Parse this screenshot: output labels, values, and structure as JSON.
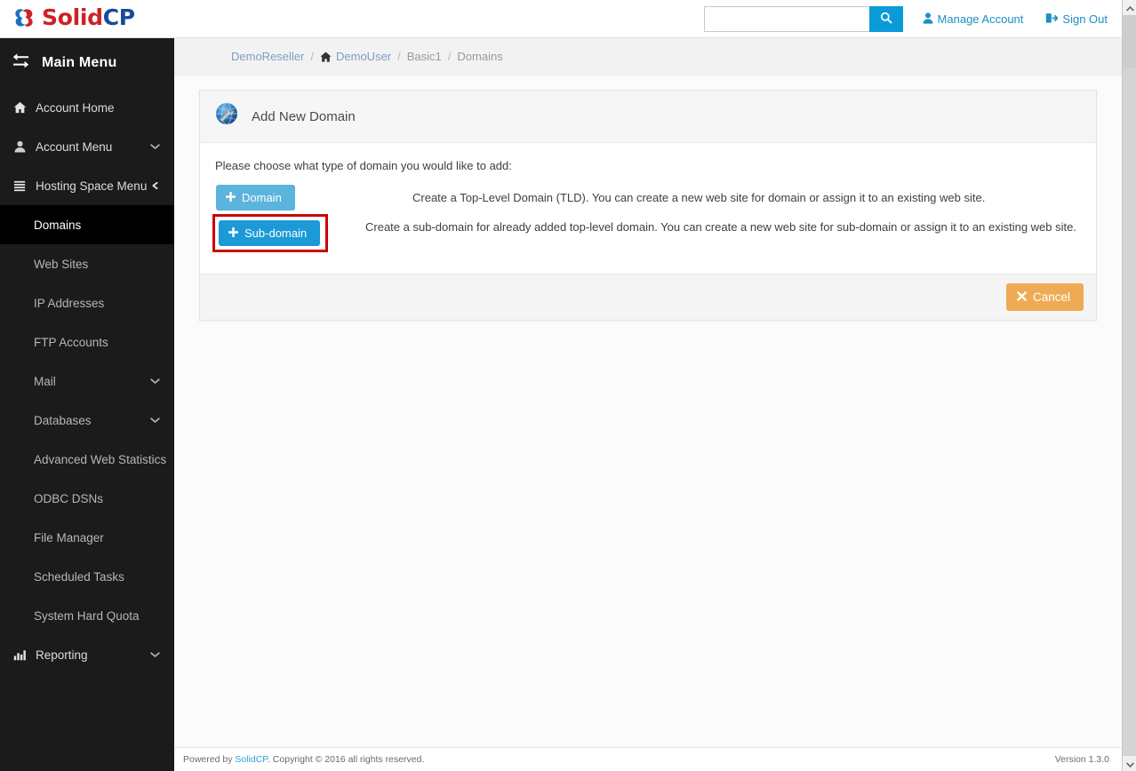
{
  "brand": {
    "logo_solid": "Solid",
    "logo_cp": "CP",
    "logo_icon": "solidcp-cloud-logo-icon",
    "accent_blue": "#0b9bd8",
    "logo_red": "#cf2026",
    "logo_navy": "#1b4a9c"
  },
  "header": {
    "search_value": "",
    "search_placeholder": "",
    "search_icon": "search-icon",
    "manage_account_label": "Manage Account",
    "manage_account_icon": "user-icon",
    "sign_out_label": "Sign Out",
    "sign_out_icon": "sign-out-icon"
  },
  "sidebar": {
    "title": "Main Menu",
    "title_icon": "exchange-arrows-icon",
    "items": [
      {
        "label": "Account Home",
        "icon": "home-icon",
        "level": 1,
        "chevron": "",
        "active": false
      },
      {
        "label": "Account Menu",
        "icon": "user-icon",
        "level": 1,
        "chevron": "down",
        "active": false
      },
      {
        "label": "Hosting Space Menu",
        "icon": "list-icon",
        "level": 1,
        "chevron": "left",
        "active": false
      },
      {
        "label": "Domains",
        "icon": "",
        "level": 2,
        "chevron": "",
        "active": true
      },
      {
        "label": "Web Sites",
        "icon": "",
        "level": 2,
        "chevron": "",
        "active": false
      },
      {
        "label": "IP Addresses",
        "icon": "",
        "level": 2,
        "chevron": "",
        "active": false
      },
      {
        "label": "FTP Accounts",
        "icon": "",
        "level": 2,
        "chevron": "",
        "active": false
      },
      {
        "label": "Mail",
        "icon": "",
        "level": 2,
        "chevron": "down",
        "active": false
      },
      {
        "label": "Databases",
        "icon": "",
        "level": 2,
        "chevron": "down",
        "active": false
      },
      {
        "label": "Advanced Web Statistics",
        "icon": "",
        "level": 2,
        "chevron": "",
        "active": false
      },
      {
        "label": "ODBC DSNs",
        "icon": "",
        "level": 2,
        "chevron": "",
        "active": false
      },
      {
        "label": "File Manager",
        "icon": "",
        "level": 2,
        "chevron": "",
        "active": false
      },
      {
        "label": "Scheduled Tasks",
        "icon": "",
        "level": 2,
        "chevron": "",
        "active": false
      },
      {
        "label": "System Hard Quota",
        "icon": "",
        "level": 2,
        "chevron": "",
        "active": false
      },
      {
        "label": "Reporting",
        "icon": "chart-bar-icon",
        "level": 1,
        "chevron": "down",
        "active": false
      }
    ]
  },
  "breadcrumb": {
    "items": [
      {
        "label": "DemoReseller",
        "type": "link",
        "icon": ""
      },
      {
        "label": "DemoUser",
        "type": "link",
        "icon": "home-icon"
      },
      {
        "label": "Basic1",
        "type": "static",
        "icon": ""
      },
      {
        "label": "Domains",
        "type": "static",
        "icon": ""
      }
    ],
    "separator": "/"
  },
  "panel": {
    "title": "Add New Domain",
    "title_icon": "globe-wrench-icon",
    "prompt": "Please choose what type of domain you would like to add:",
    "choices": [
      {
        "button_label": "Domain",
        "button_icon": "plus-icon",
        "button_style": "pale",
        "highlighted": false,
        "description": "Create a Top-Level Domain (TLD). You can create a new web site for domain or assign it to an existing web site."
      },
      {
        "button_label": "Sub-domain",
        "button_icon": "plus-icon",
        "button_style": "vivid",
        "highlighted": true,
        "description": "Create a sub-domain for already added top-level domain. You can create a new web site for sub-domain or assign it to an existing web site."
      }
    ],
    "cancel_label": "Cancel",
    "cancel_icon": "close-x-icon",
    "highlight_color": "#cc0000"
  },
  "footer": {
    "prefix": "Powered by ",
    "link_label": "SolidCP",
    "suffix": ". Copyright © 2016 all rights reserved.",
    "version": "Version 1.3.0"
  },
  "scrollbar": {
    "up_arrow": "chevron-up-icon",
    "down_arrow": "chevron-down-icon"
  }
}
